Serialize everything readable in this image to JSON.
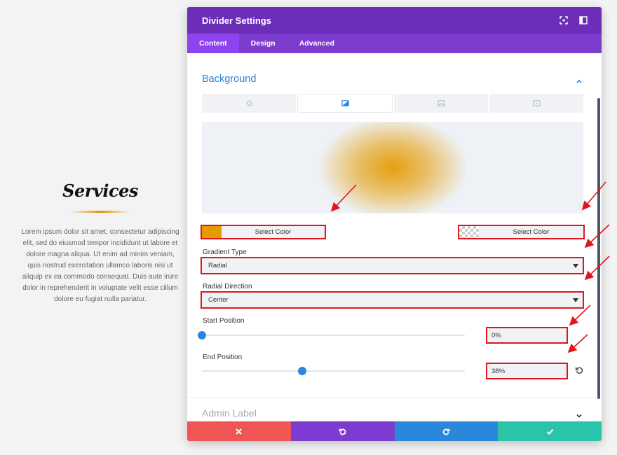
{
  "preview": {
    "title": "Services",
    "body": "Lorem ipsum dolor sit amet, consectetur adipiscing elit, sed do eiusmod tempor incididunt ut labore et dolore magna aliqua. Ut enim ad minim veniam, quis nostrud exercitation ullamco laboris nisi ut aliquip ex ea commodo consequat. Duis aute irure dolor in reprehenderit in voluptate velit esse cillum dolore eu fugiat nulla pariatur."
  },
  "modal": {
    "title": "Divider Settings",
    "tabs": [
      "Content",
      "Design",
      "Advanced"
    ],
    "active_tab": "Content"
  },
  "background": {
    "section_title": "Background",
    "bg_tabs": [
      "paint-bucket-icon",
      "gradient-icon",
      "image-icon",
      "video-icon"
    ],
    "active_bg_tab": "gradient-icon",
    "color1": {
      "label": "Select Color",
      "color": "#e39b00"
    },
    "color2": {
      "label": "Select Color",
      "color": "transparent"
    },
    "gradient_type": {
      "label": "Gradient Type",
      "value": "Radial"
    },
    "radial_direction": {
      "label": "Radial Direction",
      "value": "Center"
    },
    "start_position": {
      "label": "Start Position",
      "value": "0%",
      "percent": 0
    },
    "end_position": {
      "label": "End Position",
      "value": "38%",
      "percent": 38
    }
  },
  "admin": {
    "label": "Admin Label"
  },
  "colors": {
    "header": "#6c2eb9",
    "tabs": "#7e3bd0",
    "accent_blue": "#2b87da",
    "annotation_red": "#e1161d",
    "discard": "#ef5555",
    "save": "#29c4a9"
  }
}
